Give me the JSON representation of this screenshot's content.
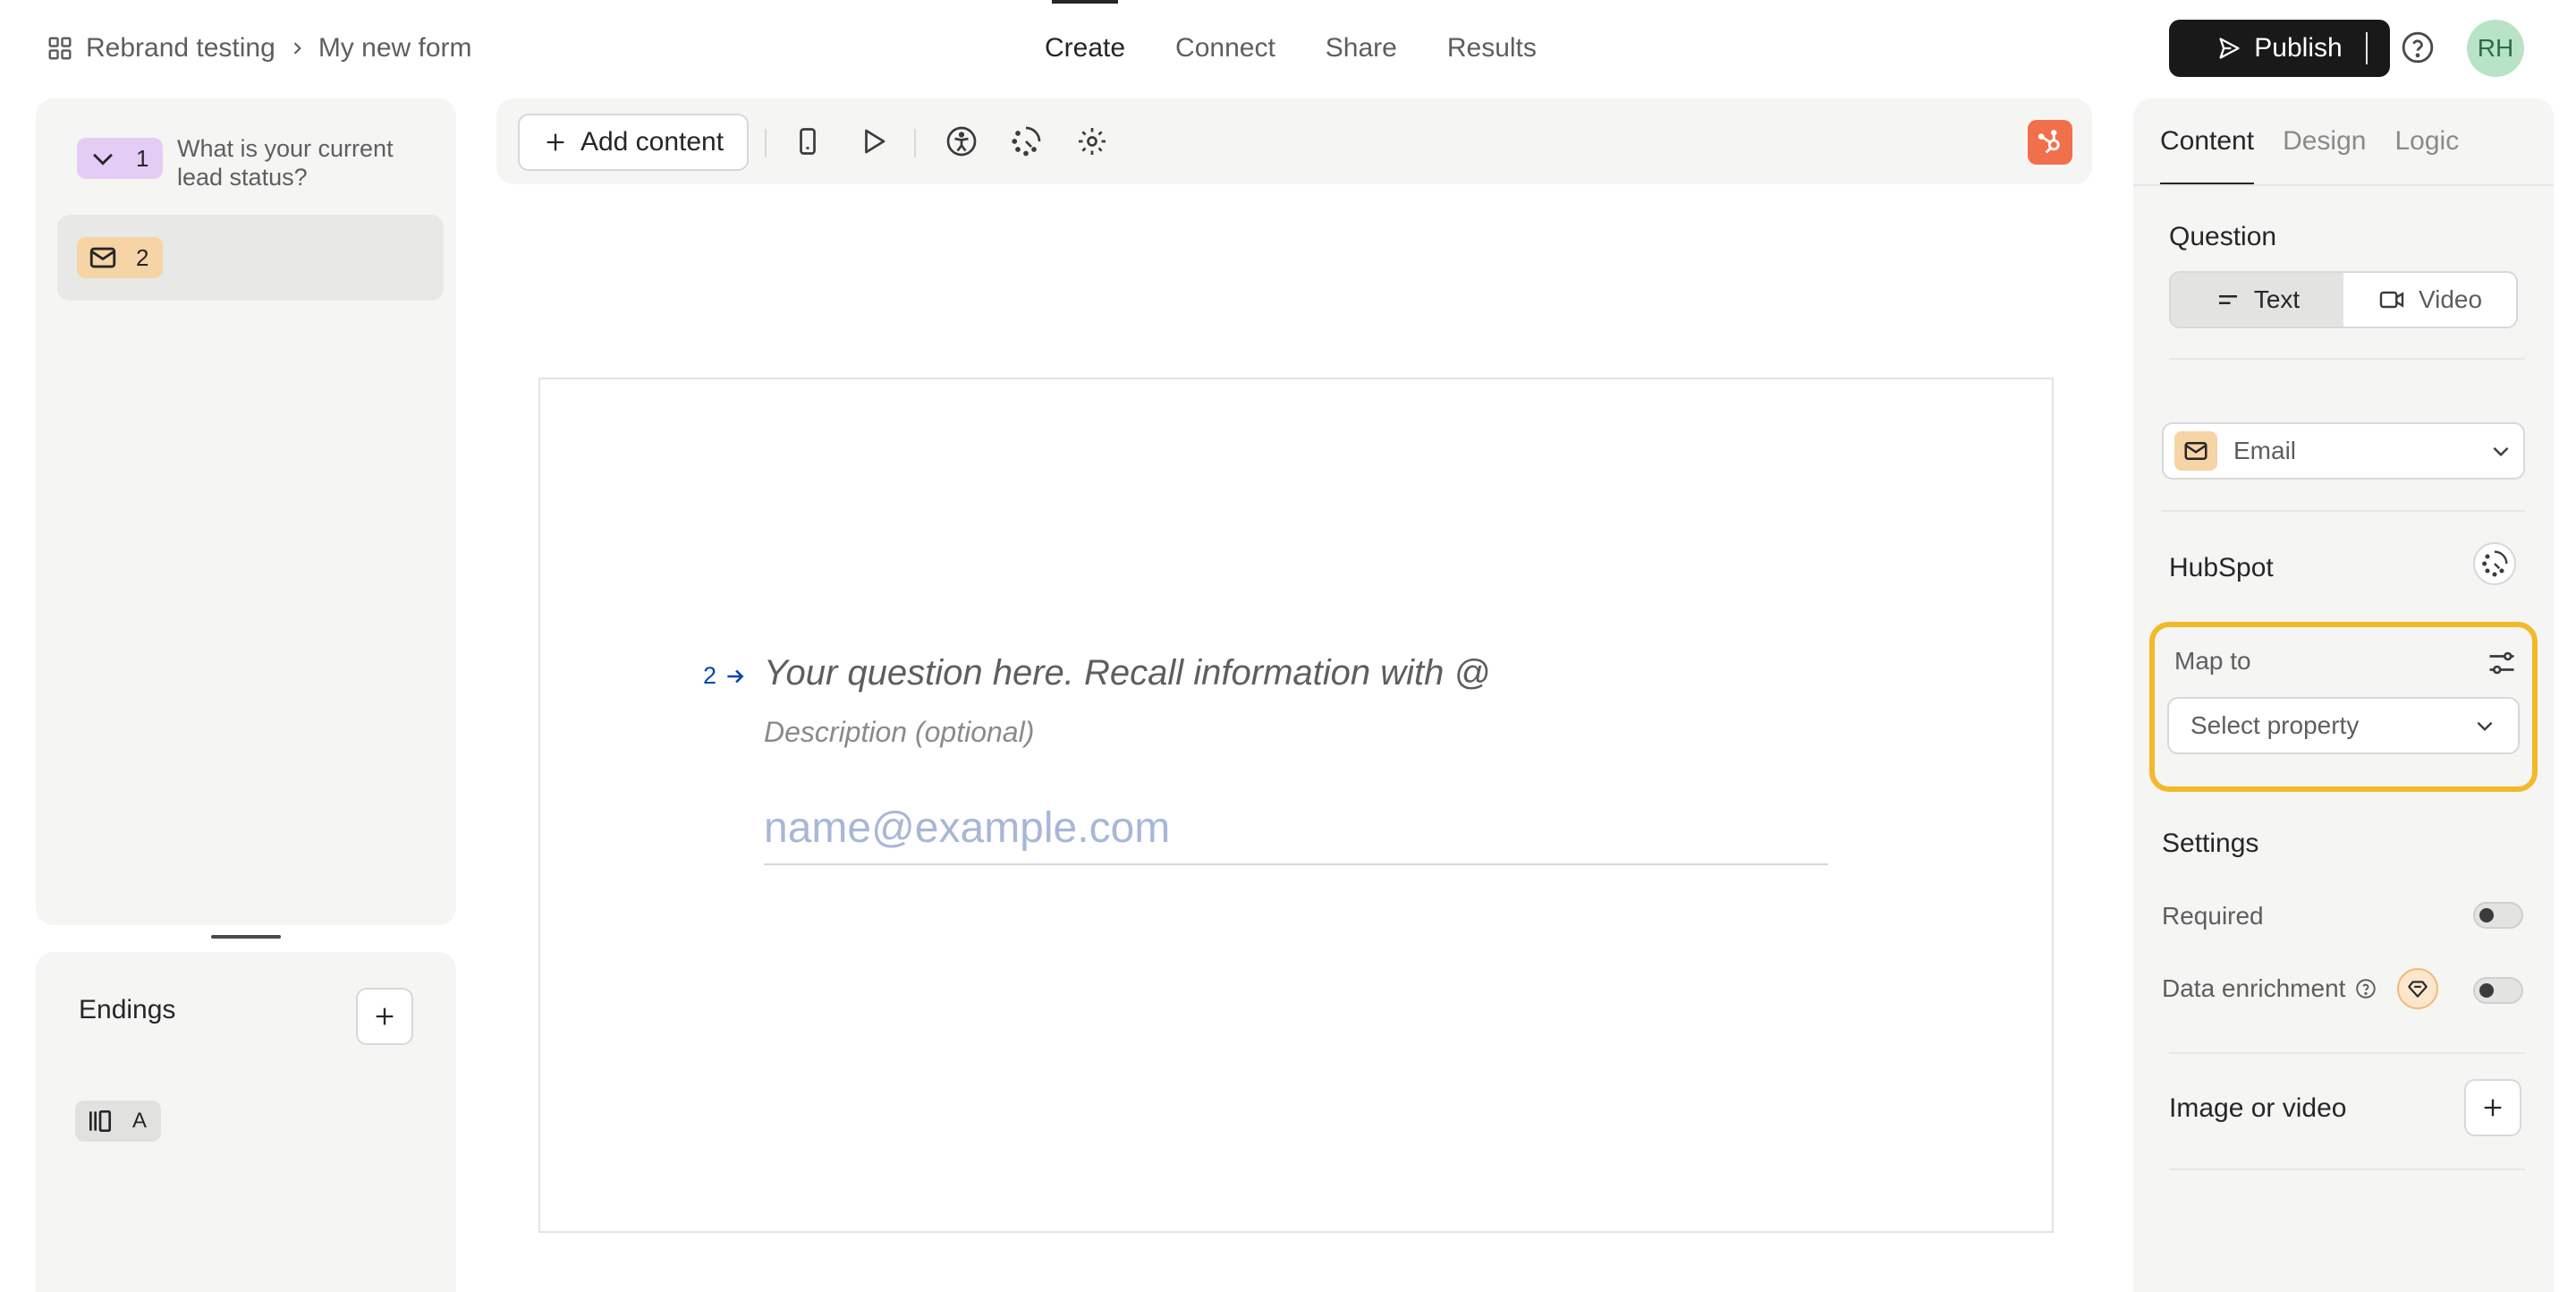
{
  "breadcrumb": {
    "workspace": "Rebrand testing",
    "form": "My new form"
  },
  "nav": {
    "tabs": [
      "Create",
      "Connect",
      "Share",
      "Results"
    ],
    "active": "Create"
  },
  "header": {
    "publish_label": "Publish",
    "avatar_initials": "RH"
  },
  "sidebar": {
    "questions": [
      {
        "number": "1",
        "text": "What is your current lead status?",
        "type_icon": "chevron-down-icon",
        "color": "#e3cdf5"
      },
      {
        "number": "2",
        "text": "",
        "type_icon": "mail-icon",
        "color": "#f6d4a5"
      }
    ],
    "endings_title": "Endings",
    "endings": [
      {
        "label": "A",
        "icon": "ending-icon"
      }
    ]
  },
  "toolbar": {
    "add_content_label": "Add content",
    "accent": "#f0704c"
  },
  "canvas": {
    "question_number": "2",
    "question_placeholder": "Your question here. Recall information with @",
    "description_placeholder": "Description (optional)",
    "email_placeholder": "name@example.com",
    "number_color": "#0445af"
  },
  "panel": {
    "tabs": [
      "Content",
      "Design",
      "Logic"
    ],
    "active_tab": "Content",
    "question_label": "Question",
    "mode_text": "Text",
    "mode_video": "Video",
    "type_label": "Email",
    "hubspot_label": "HubSpot",
    "map_to_label": "Map to",
    "select_property_placeholder": "Select property",
    "settings_label": "Settings",
    "required_label": "Required",
    "data_enrichment_label": "Data enrichment",
    "image_video_label": "Image or video",
    "highlight_color": "#f2b929"
  }
}
